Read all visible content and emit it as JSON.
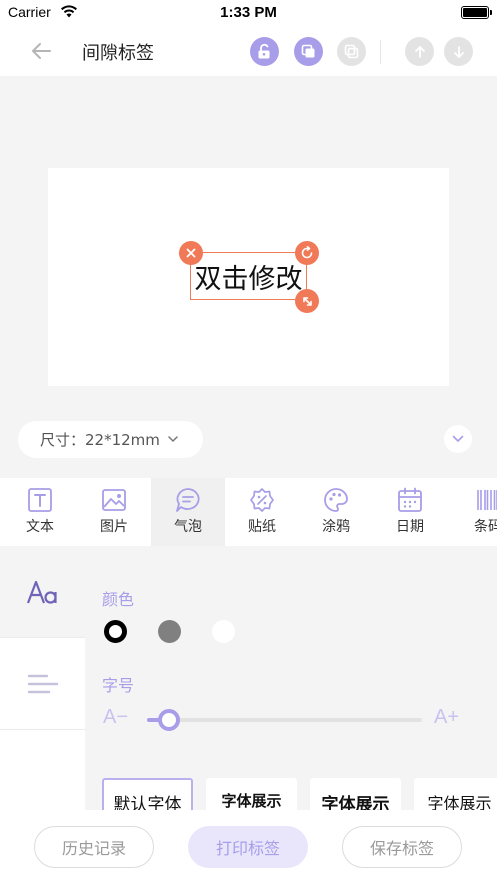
{
  "status_bar": {
    "carrier": "Carrier",
    "time": "1:33 PM"
  },
  "nav": {
    "title": "间隙标签",
    "icons": [
      "unlock-icon",
      "copy-icon",
      "duplicate-icon",
      "arrow-up-icon",
      "arrow-down-icon"
    ]
  },
  "canvas": {
    "element_text": "双击修改",
    "size_label": "尺寸：22*12mm"
  },
  "toolbar": {
    "tabs": [
      {
        "label": "文本",
        "icon": "text-icon"
      },
      {
        "label": "图片",
        "icon": "image-icon"
      },
      {
        "label": "气泡",
        "icon": "bubble-icon"
      },
      {
        "label": "贴纸",
        "icon": "sticker-icon"
      },
      {
        "label": "涂鸦",
        "icon": "palette-icon"
      },
      {
        "label": "日期",
        "icon": "calendar-icon"
      },
      {
        "label": "条码",
        "icon": "barcode-icon"
      }
    ],
    "selected": "气泡"
  },
  "side_panel": {
    "items": [
      "font-style-icon",
      "align-icon"
    ]
  },
  "properties": {
    "color_label": "颜色",
    "colors": [
      "#000000",
      "#808080",
      "#ffffff"
    ],
    "selected_color": "#000000",
    "font_size_label": "字号",
    "slider_min_label": "A−",
    "slider_max_label": "A+",
    "font_size_fraction": 0.08,
    "fonts": [
      "默认字体",
      "字体展示",
      "字体展示",
      "字体展示"
    ],
    "selected_font": "默认字体"
  },
  "bottom_bar": {
    "history": "历史记录",
    "print": "打印标签",
    "save": "保存标签"
  },
  "colors": {
    "accent": "#a79de8",
    "handle": "#f07a58"
  }
}
